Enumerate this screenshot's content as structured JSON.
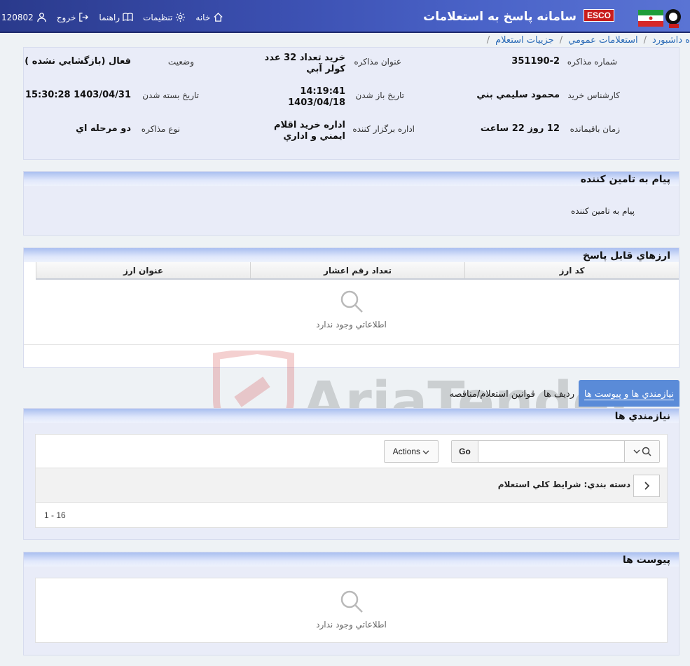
{
  "header": {
    "system_title": "سامانه پاسخ به استعلامات",
    "brand_badge": "ESCO",
    "nav": [
      {
        "label": "خانه",
        "icon": "home-icon"
      },
      {
        "label": "تنظيمات",
        "icon": "gear-icon"
      },
      {
        "label": "راهنما",
        "icon": "book-icon"
      },
      {
        "label": "خروج",
        "icon": "logout-icon"
      },
      {
        "label": "120802",
        "icon": "user-icon"
      }
    ]
  },
  "breadcrumb": [
    "ه داشبورد",
    "استعلامات عمومي",
    "جزييات استعلام"
  ],
  "info": {
    "col1": [
      {
        "label": "شماره مذاکره",
        "value": "351190-2"
      },
      {
        "label": "کارشناس خريد",
        "value": "محمود سليمي بني"
      },
      {
        "label": "زمان باقيمانده",
        "value": "12 روز 22 ساعت"
      }
    ],
    "col2": [
      {
        "label": "عنوان مذاکره",
        "value": "خريد تعداد 32 عدد کولر آبي"
      },
      {
        "label": "تاريخ باز شدن",
        "value": "14:19:41 1403/04/18"
      },
      {
        "label": "اداره برگزار کننده",
        "value": "اداره خريد اقلام ايمني و اداري"
      }
    ],
    "col3": [
      {
        "label": "وضعيت",
        "value": "فعال (بازگشايي نشده )"
      },
      {
        "label": "تاريخ بسته شدن",
        "value": "1403/04/31 15:30:28"
      },
      {
        "label": "نوع مذاکره",
        "value": "دو مرحله اي"
      }
    ]
  },
  "supplier_message": {
    "title": "پيام به تامين کننده",
    "body": "پيام به تامين کننده"
  },
  "currencies": {
    "title": "ارزهاي قابل پاسخ",
    "columns": [
      "کد ارز",
      "تعداد رقم اعشار",
      "عنوان ارز"
    ],
    "empty_text": "اطلاعاتي وجود ندارد"
  },
  "tabs": [
    {
      "label": "نيازمندي ها و پيوست ها",
      "active": true
    },
    {
      "label": "رديف ها",
      "active": false
    },
    {
      "label": "قوانين استعلام/مناقصه",
      "active": false
    }
  ],
  "requirements": {
    "title": "نيازمندي ها",
    "search_placeholder": "",
    "go_label": "Go",
    "actions_label": "Actions",
    "group_label": "دسته بندي: شرايط کلي استعلام",
    "pager": "1 - 16"
  },
  "attachments": {
    "title": "پيوست ها",
    "empty_text": "اطلاعاتي وجود ندارد"
  },
  "watermark": "AriaTender.neT"
}
